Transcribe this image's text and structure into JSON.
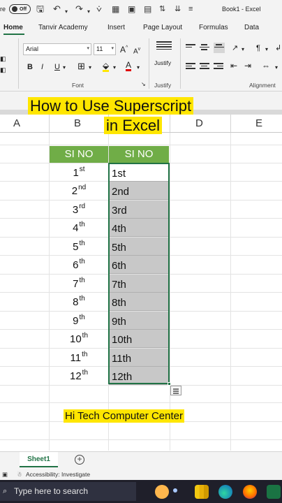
{
  "titlebar": {
    "clipped_text": "re",
    "autosave_state": "Off",
    "window_title": "Book1 - Excel"
  },
  "ribbon": {
    "tabs": [
      "Home",
      "Tanvir Academy",
      "Insert",
      "Page Layout",
      "Formulas",
      "Data"
    ],
    "active_tab": "Home",
    "font_name": "Arial",
    "font_size": "11",
    "grow_font": "A",
    "shrink_font": "A",
    "bold": "B",
    "italic": "I",
    "underline": "U",
    "justify_label": "Justify",
    "groups": {
      "font": "Font",
      "justify": "Justify",
      "alignment": "Alignment"
    }
  },
  "banner": {
    "line1": "How to Use Superscript",
    "line2": "in Excel"
  },
  "columns": [
    "A",
    "B",
    "C",
    "D",
    "E"
  ],
  "table": {
    "header_b": "SI NO",
    "header_c": "SI NO",
    "rows": [
      {
        "num": "1",
        "sup": "st",
        "text": "1st"
      },
      {
        "num": "2",
        "sup": "nd",
        "text": "2nd"
      },
      {
        "num": "3",
        "sup": "rd",
        "text": "3rd"
      },
      {
        "num": "4",
        "sup": "th",
        "text": "4th"
      },
      {
        "num": "5",
        "sup": "th",
        "text": "5th"
      },
      {
        "num": "6",
        "sup": "th",
        "text": "6th"
      },
      {
        "num": "7",
        "sup": "th",
        "text": "7th"
      },
      {
        "num": "8",
        "sup": "th",
        "text": "8th"
      },
      {
        "num": "9",
        "sup": "th",
        "text": "9th"
      },
      {
        "num": "10",
        "sup": "th",
        "text": "10th"
      },
      {
        "num": "11",
        "sup": "th",
        "text": "11th"
      },
      {
        "num": "12",
        "sup": "th",
        "text": "12th"
      }
    ]
  },
  "footer_label": "Hi Tech Computer Center",
  "sheet": {
    "tab": "Sheet1"
  },
  "status": {
    "accessibility": "Accessibility: Investigate"
  },
  "taskbar": {
    "search_placeholder": "Type here to search"
  },
  "colors": {
    "excel_green": "#217346",
    "header_green": "#70ad47",
    "highlight_yellow": "#ffe600"
  }
}
